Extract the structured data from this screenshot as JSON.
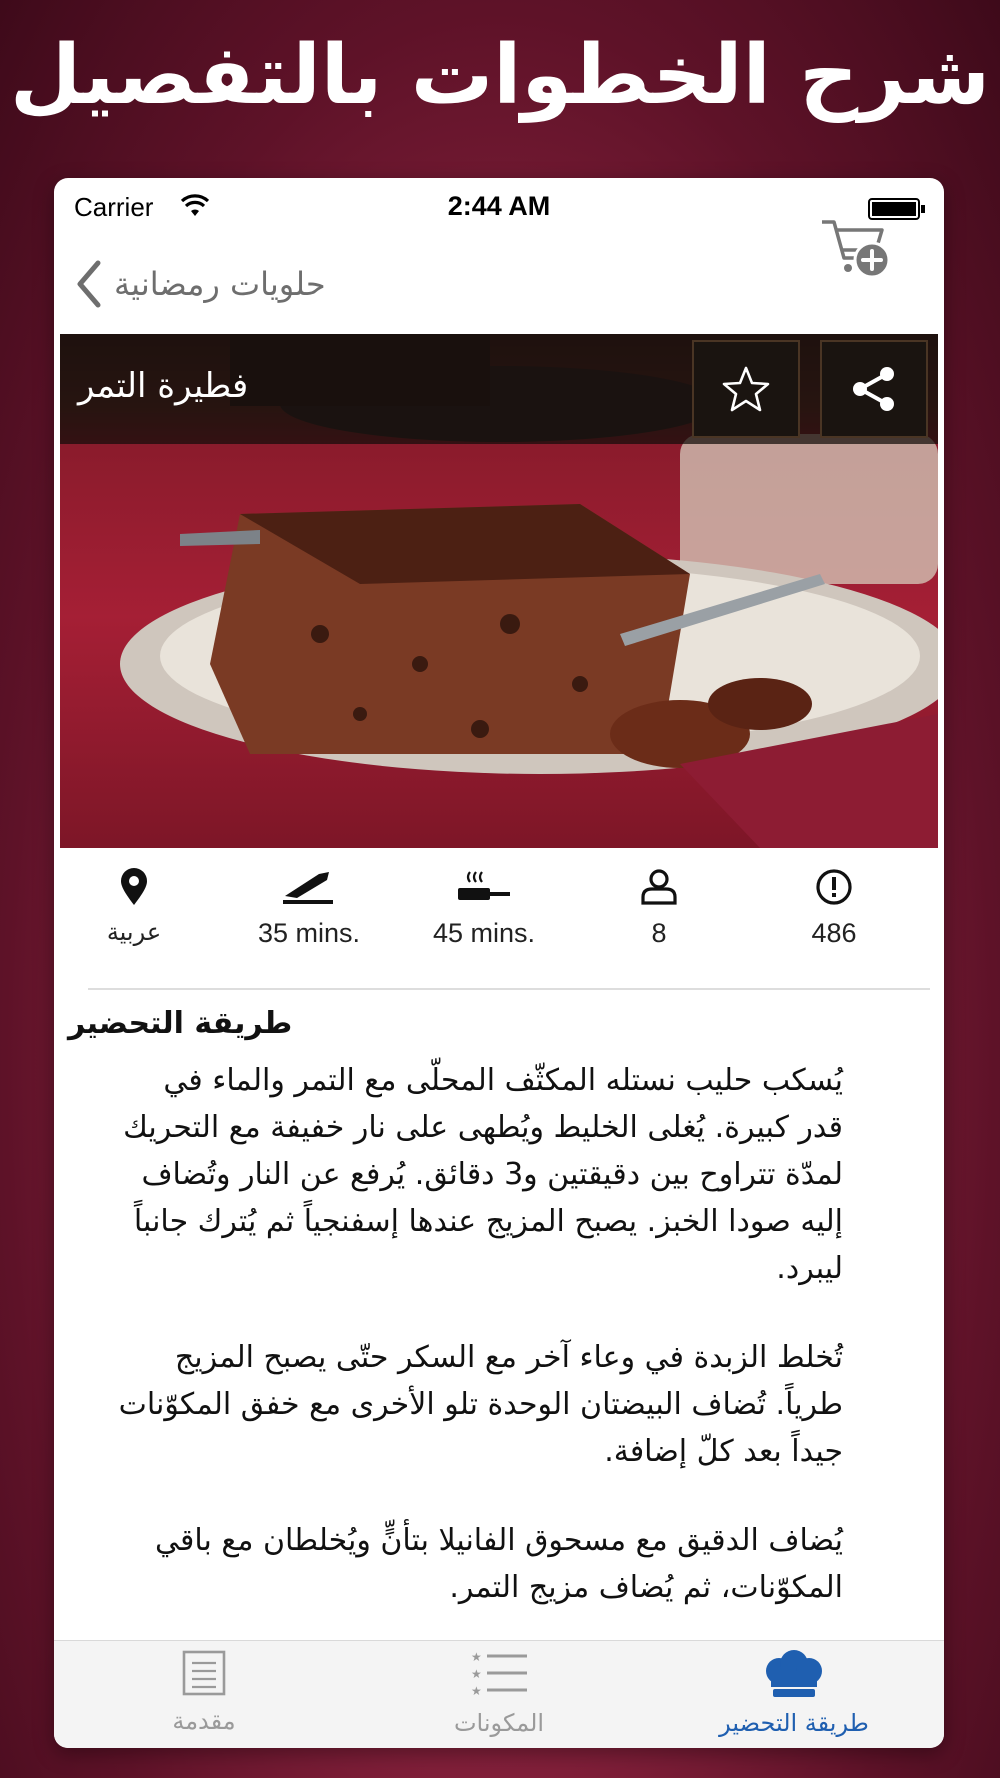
{
  "promo": {
    "title": "شرح الخطوات بالتفصيل"
  },
  "status_bar": {
    "carrier": "Carrier",
    "time": "2:44 AM"
  },
  "nav": {
    "back_label": "حلويات رمضانية"
  },
  "recipe": {
    "title": "فطيرة التمر"
  },
  "stats": {
    "cuisine": "عربية",
    "prep_time": "35 mins.",
    "cook_time": "45 mins.",
    "servings": "8",
    "views": "486"
  },
  "content": {
    "title": "طريقة التحضير",
    "paragraphs": [
      "يُسكب حليب نستله المكثّف المحلّى مع التمر والماء في قدر كبيرة. يُغلى الخليط ويُطهى على نار خفيفة مع التحريك لمدّة تتراوح بين دقيقتين و3 دقائق. يُرفع عن النار وتُضاف إليه صودا الخبز. يصبح المزيج عندها إسفنجياً ثم يُترك جانباً ليبرد.",
      "تُخلط الزبدة في وعاء آخر مع السكر حتّى يصبح المزيج طرياً. تُضاف البيضتان الوحدة تلو الأخرى مع خفق المكوّنات جيداً بعد كلّ إضافة.",
      "يُضاف الدقيق مع مسحوق الفانيلا بتأنٍّ ويُخلطان مع باقي المكوّنات، ثم يُضاف مزيج التمر."
    ]
  },
  "tabs": [
    {
      "label": "مقدمة",
      "icon": "document-icon"
    },
    {
      "label": "المكونات",
      "icon": "list-icon"
    },
    {
      "label": "طريقة التحضير",
      "icon": "chef-hat-icon",
      "active": true
    }
  ],
  "colors": {
    "accent": "#1f5fb0",
    "tab_inactive": "#9a9a9a",
    "background": "#8e2440"
  }
}
